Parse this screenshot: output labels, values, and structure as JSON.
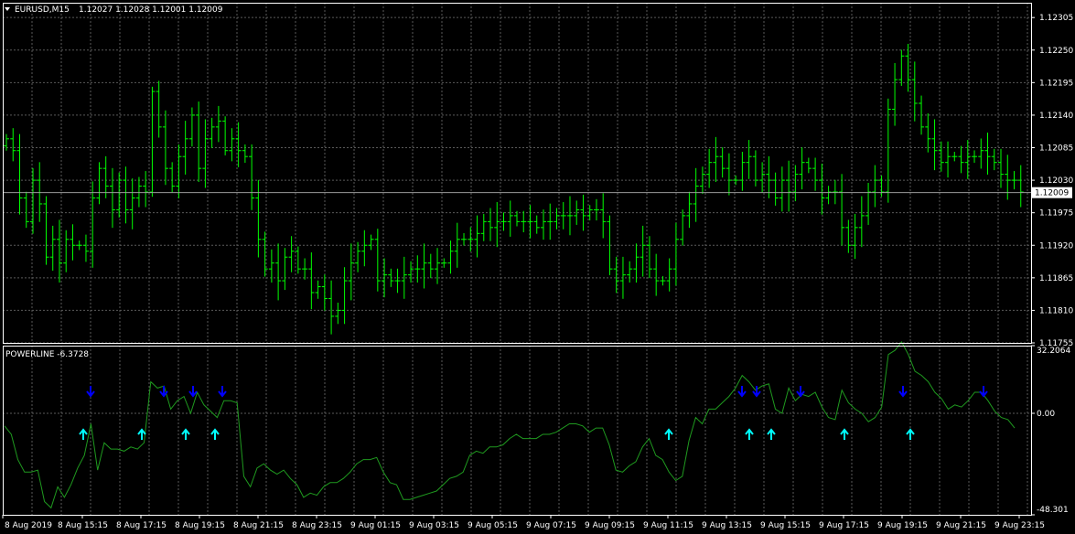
{
  "header": {
    "symbol_label": "EURUSD,M15",
    "quote": "1.12027 1.12028 1.12001 1.12009"
  },
  "indicator": {
    "label": "POWERLINE -6.3728",
    "scale_labels": [
      "32.2064",
      "0.00",
      "-48.301"
    ]
  },
  "colors": {
    "background": "#000000",
    "candle": "#00ff00",
    "grid": "#5a5a5a",
    "indicator_line": "#1f9a1f",
    "arrow_down": "#0000ff",
    "arrow_up": "#00ffff",
    "frame": "#ffffff"
  },
  "icons": {
    "menu": "triangle-down-icon",
    "sell_signal": "arrow-down-icon",
    "buy_signal": "arrow-up-icon"
  },
  "chart_data": [
    {
      "type": "candlestick",
      "ylim": [
        1.11755,
        1.1233
      ],
      "y_ticks": [
        "1.12305",
        "1.12250",
        "1.12195",
        "1.12140",
        "1.12085",
        "1.12030",
        "1.11975",
        "1.11920",
        "1.11865",
        "1.11810",
        "1.11755"
      ],
      "current_price": "1.12009",
      "x_labels": [
        "8 Aug 2019",
        "8 Aug 15:15",
        "8 Aug 17:15",
        "8 Aug 19:15",
        "8 Aug 21:15",
        "8 Aug 23:15",
        "9 Aug 01:15",
        "9 Aug 03:15",
        "9 Aug 05:15",
        "9 Aug 07:15",
        "9 Aug 09:15",
        "9 Aug 11:15",
        "9 Aug 13:15",
        "9 Aug 15:15",
        "9 Aug 17:15",
        "9 Aug 19:15",
        "9 Aug 21:15",
        "9 Aug 23:15"
      ],
      "close": [
        1.121,
        1.1208,
        1.12,
        1.1196,
        1.1203,
        1.1199,
        1.119,
        1.1193,
        1.1189,
        1.1193,
        1.1192,
        1.1192,
        1.1191,
        1.12,
        1.1205,
        1.1202,
        1.1198,
        1.1203,
        1.1198,
        1.12,
        1.1202,
        1.1201,
        1.1218,
        1.1212,
        1.1205,
        1.1202,
        1.1207,
        1.121,
        1.1214,
        1.1205,
        1.121,
        1.1212,
        1.1213,
        1.1208,
        1.121,
        1.1208,
        1.1207,
        1.12,
        1.1193,
        1.1188,
        1.1189,
        1.1186,
        1.119,
        1.1191,
        1.1188,
        1.1188,
        1.1184,
        1.1185,
        1.1183,
        1.118,
        1.1181,
        1.1186,
        1.1189,
        1.1191,
        1.1192,
        1.1193,
        1.1186,
        1.1187,
        1.1186,
        1.1186,
        1.1187,
        1.1188,
        1.1188,
        1.1189,
        1.1188,
        1.1189,
        1.1189,
        1.1191,
        1.1193,
        1.1193,
        1.1193,
        1.1194,
        1.1196,
        1.1195,
        1.1196,
        1.1196,
        1.1197,
        1.1196,
        1.1196,
        1.1196,
        1.1195,
        1.1196,
        1.1196,
        1.1197,
        1.1197,
        1.1197,
        1.1198,
        1.1197,
        1.1198,
        1.1198,
        1.1196,
        1.1188,
        1.1186,
        1.1187,
        1.1188,
        1.119,
        1.1192,
        1.1188,
        1.1186,
        1.1186,
        1.1188,
        1.1193,
        1.1197,
        1.1199,
        1.1202,
        1.1204,
        1.1206,
        1.1207,
        1.1205,
        1.1203,
        1.1203,
        1.1206,
        1.1207,
        1.1203,
        1.1204,
        1.1203,
        1.12,
        1.1203,
        1.1201,
        1.1204,
        1.1206,
        1.1205,
        1.1203,
        1.12,
        1.1201,
        1.1201,
        1.1195,
        1.1192,
        1.1195,
        1.1197,
        1.1201,
        1.1203,
        1.1201,
        1.1215,
        1.122,
        1.1224,
        1.122,
        1.1216,
        1.1212,
        1.121,
        1.1208,
        1.1206,
        1.1207,
        1.1207,
        1.1206,
        1.1207,
        1.1207,
        1.1208,
        1.1207,
        1.1206,
        1.1204,
        1.1203,
        1.1203,
        1.1201
      ]
    },
    {
      "type": "line",
      "name": "POWERLINE",
      "ylim": [
        -48.301,
        32.2064
      ],
      "values": [
        -6,
        -10,
        -22,
        -28,
        -28,
        -27,
        -42,
        -45,
        -35,
        -40,
        -34,
        -26,
        -20,
        -5,
        -27,
        -14,
        -17,
        -17,
        -18,
        -16,
        -17,
        -14,
        15,
        12,
        13,
        2,
        6,
        8,
        0,
        10,
        4,
        1,
        -2,
        6,
        6,
        5,
        -30,
        -35,
        -26,
        -24,
        -27,
        -29,
        -27,
        -31,
        -34,
        -40,
        -38,
        -39,
        -35,
        -33,
        -33,
        -31,
        -28,
        -24,
        -22,
        -22,
        -21,
        -28,
        -33,
        -34,
        -41,
        -41,
        -40,
        -39,
        -38,
        -37,
        -34,
        -31,
        -30,
        -28,
        -20,
        -18,
        -19,
        -16,
        -16,
        -15,
        -12,
        -10,
        -12,
        -12,
        -12,
        -10,
        -10,
        -9,
        -7,
        -5,
        -5,
        -6,
        -9,
        -7,
        -7,
        -15,
        -27,
        -28,
        -25,
        -23,
        -16,
        -12,
        -20,
        -22,
        -28,
        -32,
        -30,
        -13,
        -2,
        -5,
        2,
        2,
        5,
        8,
        12,
        18,
        15,
        11,
        13,
        14,
        2,
        0,
        12,
        6,
        9,
        8,
        10,
        3,
        -2,
        -3,
        11,
        5,
        2,
        0,
        -4,
        -2,
        3,
        28,
        30,
        34,
        28,
        20,
        18,
        15,
        10,
        7,
        2,
        4,
        3,
        6,
        10,
        10,
        6,
        1,
        -2,
        -3,
        -7
      ]
    }
  ],
  "signals": {
    "sell_x": [
      99,
      179,
      211,
      243,
      811,
      827,
      875,
      987,
      1075
    ],
    "buy_x": [
      91,
      155,
      203,
      235,
      731,
      819,
      843,
      923,
      995
    ]
  }
}
